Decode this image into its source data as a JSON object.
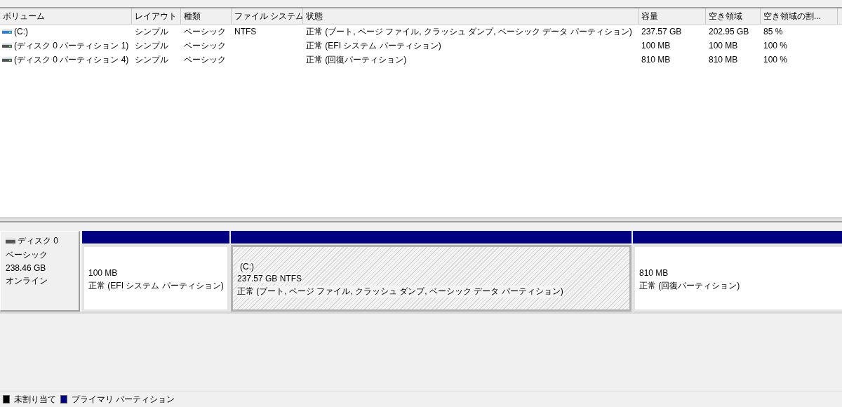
{
  "volume_list": {
    "columns": [
      {
        "label": "ボリューム"
      },
      {
        "label": "レイアウト"
      },
      {
        "label": "種類"
      },
      {
        "label": "ファイル システム"
      },
      {
        "label": "状態"
      },
      {
        "label": "容量"
      },
      {
        "label": "空き領域"
      },
      {
        "label": "空き領域の割..."
      }
    ],
    "rows": [
      {
        "kind": "boot",
        "cells": [
          "(C:)",
          "シンプル",
          "ベーシック",
          "NTFS",
          "正常 (ブート, ページ ファイル, クラッシュ ダンプ, ベーシック データ パーティション)",
          "237.57 GB",
          "202.95 GB",
          "85 %"
        ]
      },
      {
        "kind": "partition",
        "cells": [
          "(ディスク 0 パーティション 1)",
          "シンプル",
          "ベーシック",
          "",
          "正常 (EFI システム パーティション)",
          "100 MB",
          "100 MB",
          "100 %"
        ]
      },
      {
        "kind": "partition",
        "cells": [
          "(ディスク 0 パーティション 4)",
          "シンプル",
          "ベーシック",
          "",
          "正常 (回復パーティション)",
          "810 MB",
          "810 MB",
          "100 %"
        ]
      }
    ]
  },
  "disk": {
    "name": "ディスク 0",
    "type": "ベーシック",
    "size": "238.46 GB",
    "status": "オンライン",
    "partitions": [
      {
        "size": "100 MB",
        "status": "正常 (EFI システム パーティション)",
        "selected": false
      },
      {
        "label": "(C:)",
        "size": "237.57 GB NTFS",
        "status": "正常 (ブート, ページ ファイル, クラッシュ ダンプ, ベーシック データ パーティション)",
        "selected": true
      },
      {
        "size": "810 MB",
        "status": "正常 (回復パーティション)",
        "selected": false
      }
    ]
  },
  "legend": [
    {
      "label": "未割り当て",
      "color": "#000000"
    },
    {
      "label": "プライマリ パーティション",
      "color": "#000080"
    }
  ]
}
